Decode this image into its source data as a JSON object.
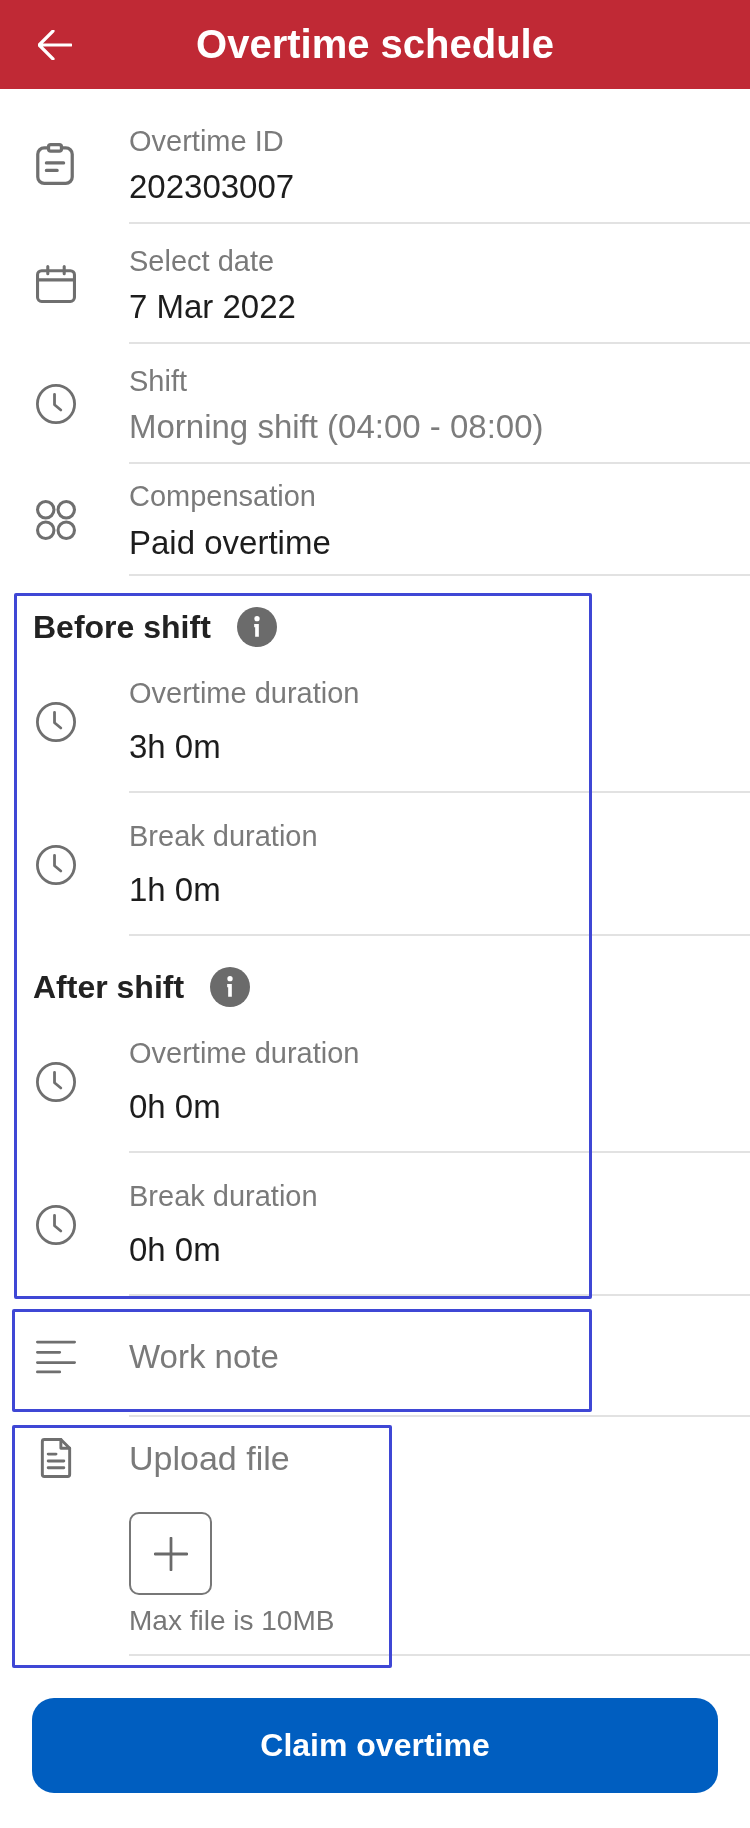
{
  "header": {
    "title": "Overtime schedule"
  },
  "fields": [
    {
      "kind": "id",
      "label": "Overtime ID",
      "value": "202303007",
      "disabled": false
    },
    {
      "kind": "date",
      "label": "Select date",
      "value": "7 Mar 2022",
      "disabled": false
    },
    {
      "kind": "shift",
      "label": "Shift",
      "value": "Morning shift (04:00 - 08:00)",
      "disabled": true
    },
    {
      "kind": "compensation",
      "label": "Compensation",
      "value": "Paid overtime",
      "disabled": false
    }
  ],
  "durations": {
    "highlighted": true,
    "sections": [
      {
        "title": "Before shift",
        "rows": [
          {
            "label": "Overtime duration",
            "value": "3h 0m"
          },
          {
            "label": "Break duration",
            "value": "1h 0m"
          }
        ]
      },
      {
        "title": "After shift",
        "rows": [
          {
            "label": "Overtime duration",
            "value": "0h 0m"
          },
          {
            "label": "Break duration",
            "value": "0h 0m"
          }
        ]
      }
    ]
  },
  "work_note": {
    "placeholder": "Work note",
    "highlighted": true
  },
  "upload": {
    "label": "Upload file",
    "hint": "Max file is 10MB",
    "highlighted": true
  },
  "submit_button": {
    "label": "Claim overtime"
  }
}
